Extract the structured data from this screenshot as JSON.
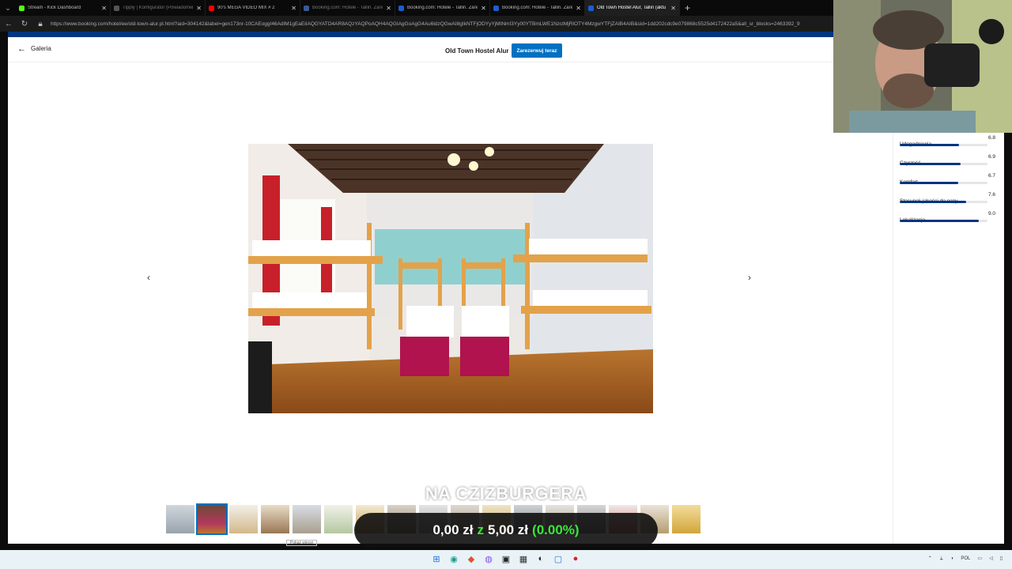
{
  "browser": {
    "tabs": [
      {
        "title": "Stream - Kick Dashboard",
        "favicon_color": "#53fc18",
        "state": "normal"
      },
      {
        "title": "Tipply | Konfigurator (Powiadomienia)",
        "favicon_color": "#555555",
        "state": "dim"
      },
      {
        "title": "90's MEGA VIDEO MIX # 2",
        "favicon_color": "#ff0000",
        "state": "normal"
      },
      {
        "title": "Booking.com: Hotele - Tallin. Zarez",
        "favicon_color": "#3b5998",
        "state": "dim"
      },
      {
        "title": "Booking.com: Hotele - Tallin. Zarez",
        "favicon_color": "#003580",
        "state": "normal"
      },
      {
        "title": "Booking.com: Hotele - Tallin. Zarez",
        "favicon_color": "#003580",
        "state": "normal"
      },
      {
        "title": "Old Town Hostel Alur, Tallin (aktu",
        "favicon_color": "#003580",
        "state": "active"
      }
    ],
    "url": "https://www.booking.com/hotel/ee/old-town-alur.pl.html?aid=304142&label=gen173nr-10CAEoggI46AdIM1gEaEiIAQGYATO4AR8AQzYAQPoAQH4AQGIAgGoAgG4Au6ldzQGwAI8gIkNTFjODYyYjMtNmI3Yy00YTBmLWE1NzctMjRlOTY4MzgwYTFjZAIB4AIB&sid=1dd202cdc9e079868c5525d4172422a5&all_sr_blocks=2463392_9"
  },
  "header": {
    "back_label": "Galeria",
    "hotel_name": "Old Town Hostel Alur",
    "reserve_label": "Zarezerwuj teraz"
  },
  "gallery": {
    "prev_icon": "chevron-left-icon",
    "next_icon": "chevron-right-icon",
    "extra_tag": "Pokaż więcej",
    "selected_thumbnail_index": 1
  },
  "ratings": [
    {
      "label": "Udogodnienia",
      "value": "6.8",
      "score": 6.8
    },
    {
      "label": "Czystość",
      "value": "6.9",
      "score": 6.9
    },
    {
      "label": "Komfort",
      "value": "6.7",
      "score": 6.7
    },
    {
      "label": "Stosunek jakości do ceny",
      "value": "7.6",
      "score": 7.6
    },
    {
      "label": "Lokalizacja",
      "value": "9.0",
      "score": 9.0
    }
  ],
  "overlay": {
    "goal_title": "NA CZIZBURGERA",
    "current": "0,00 zł",
    "separator": "z",
    "target": "5,00 zł",
    "percent": "(0.00%)"
  },
  "taskbar": {
    "tray_lang": "POL"
  },
  "colors": {
    "booking_blue": "#003580",
    "button_blue": "#0071c2",
    "overlay_green": "#39e639"
  }
}
